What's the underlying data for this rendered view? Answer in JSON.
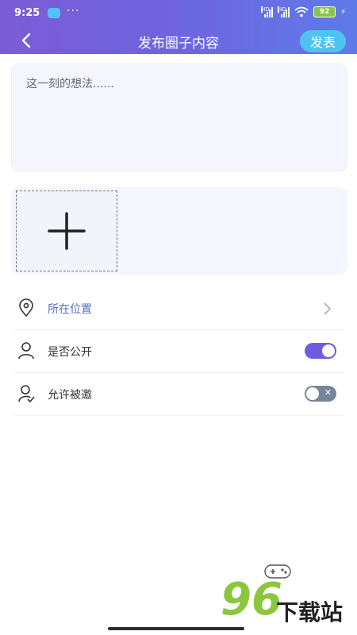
{
  "status_bar": {
    "time": "9:25",
    "dots": "···",
    "battery": "92",
    "hd1": "HD",
    "hd2": "HD"
  },
  "nav": {
    "title": "发布圈子内容",
    "publish_label": "发表"
  },
  "post": {
    "placeholder": "这一刻的想法......"
  },
  "settings": {
    "location_label": "所在位置",
    "public_label": "是否公开",
    "public_on": true,
    "invite_label": "允许被邀",
    "invite_on": false
  },
  "watermark": {
    "number": "96",
    "text": "下载站"
  },
  "colors": {
    "header_gradient_start": "#7b5cd6",
    "header_gradient_end": "#5f7ae8",
    "publish_button": "#4ec3f0",
    "toggle_on": "#6e5ce0",
    "toggle_off": "#78849a",
    "location_text": "#5a6fbf"
  }
}
